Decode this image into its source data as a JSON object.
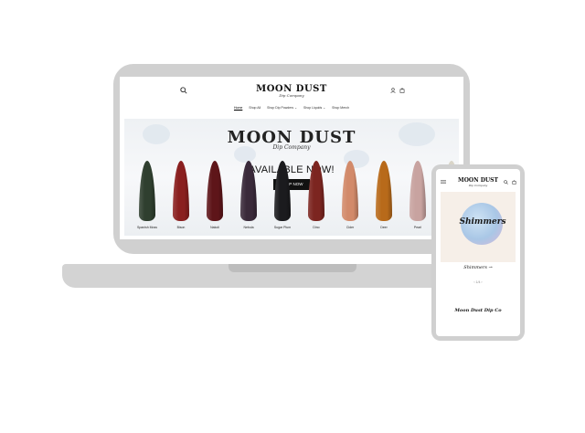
{
  "desktop": {
    "logo": "MOON DUST",
    "logo_sub": "Dip Company",
    "nav": [
      "Home",
      "Shop All",
      "Shop Dip Powders ⌄",
      "Shop Liquids ⌄",
      "Shop Merch"
    ],
    "hero": {
      "title": "MOON DUST",
      "subtitle": "Dip Company",
      "headline": "AVAILABLE NOW!",
      "button": "SHOP NOW",
      "nails": [
        {
          "label": "Spanish Moss",
          "color": "#2f3f2f"
        },
        {
          "label": "Bison",
          "color": "#8a1f1f"
        },
        {
          "label": "Nakoli",
          "color": "#5e1519"
        },
        {
          "label": "Nebula",
          "color": "#3a2a3a"
        },
        {
          "label": "Sugar Plum",
          "color": "#1b1b1e"
        },
        {
          "label": "Dino",
          "color": "#7c2520"
        },
        {
          "label": "Cider",
          "color": "#d28a6a"
        },
        {
          "label": "Deer",
          "color": "#b86a1a"
        },
        {
          "label": "Pearl",
          "color": "#c8a3a0"
        },
        {
          "label": "",
          "color": "#d9d5c8"
        }
      ]
    }
  },
  "mobile": {
    "logo": "MOON DUST",
    "logo_sub": "Dip Company",
    "card_text": "Shimmers",
    "collection_link": "Shimmers →",
    "pager": "‹   1/4   ›",
    "footer": "Moon Dust Dip Co"
  }
}
